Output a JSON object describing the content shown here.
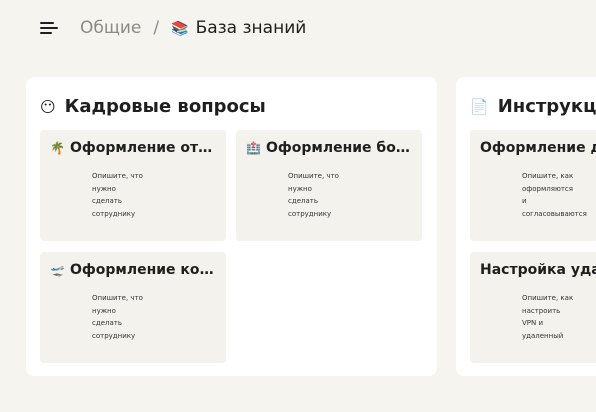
{
  "breadcrumb": {
    "parent": "Общие",
    "separator": "/",
    "current_emoji": "📚",
    "current": "База знаний"
  },
  "sections": [
    {
      "emoji": "😶",
      "title": "Кадровые вопросы",
      "cards": [
        {
          "emoji": "🌴",
          "title": "Оформление отпуска",
          "desc": "Опишите, что\nнужно\nсделать\nсотруднику"
        },
        {
          "emoji": "🏥",
          "title": "Оформление больн...",
          "desc": "Опишите, что\nнужно\nсделать\nсотруднику"
        },
        {
          "emoji": "🛫",
          "title": "Оформление коман...",
          "desc": "Опишите, что\nнужно\nсделать\nсотруднику"
        }
      ]
    },
    {
      "emoji": "📄",
      "title": "Инструкции",
      "cards": [
        {
          "emoji": "",
          "title": "Оформление док",
          "desc": "Опишите, как\nоформляются\nи\nсогласовываются"
        },
        {
          "emoji": "",
          "title": "Настройка удале",
          "desc": "Опишите, как\nнастроить\nVPN и\nудаленный"
        }
      ]
    }
  ]
}
